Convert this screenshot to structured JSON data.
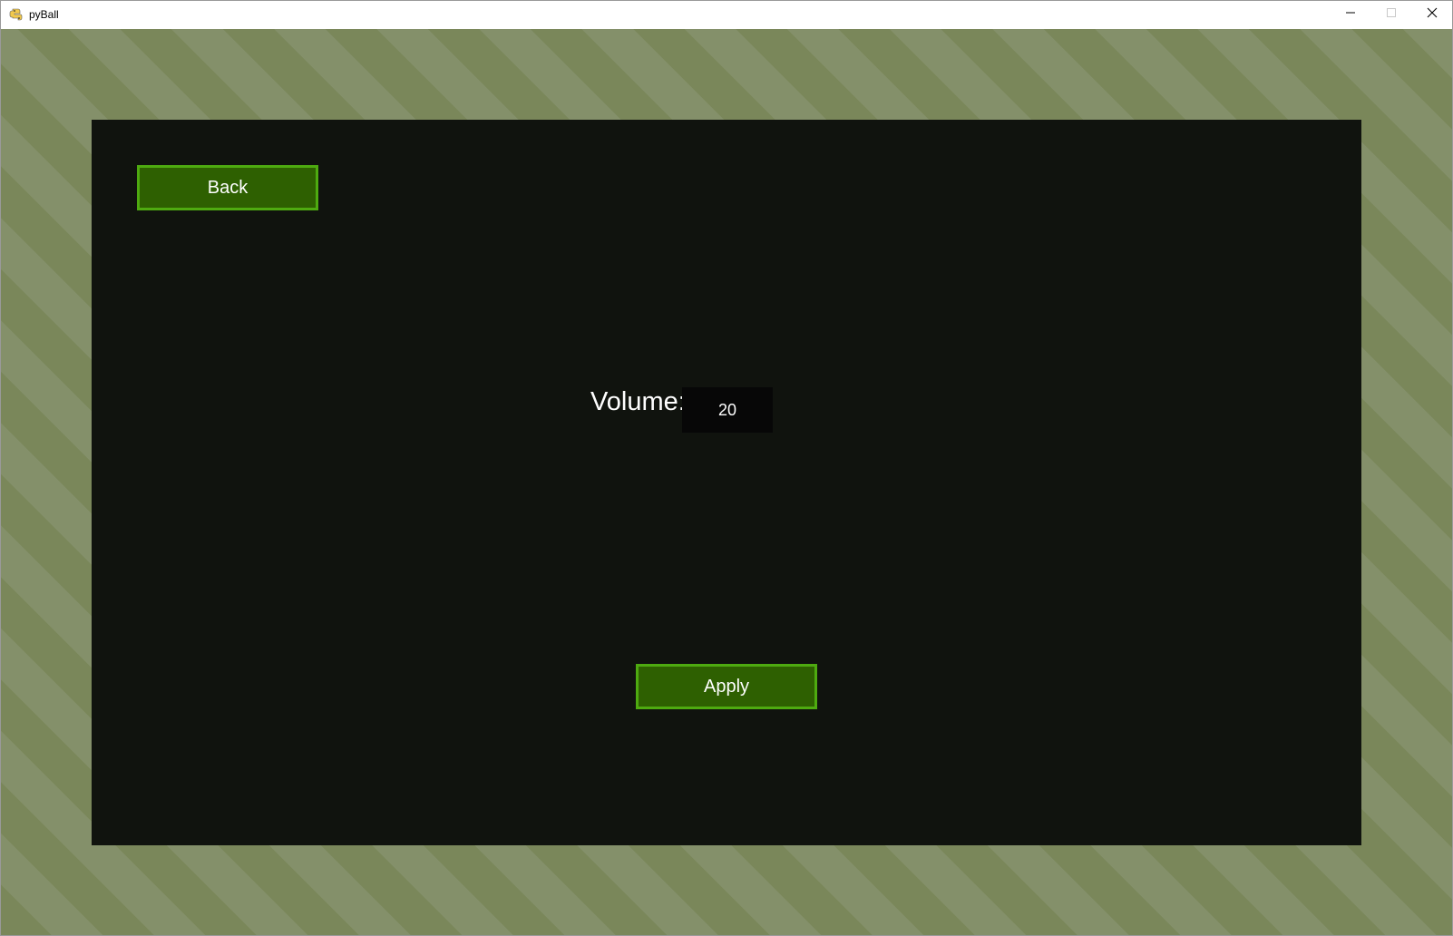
{
  "window": {
    "title": "pyBall",
    "app_icon": "python-icon",
    "controls": {
      "minimize_icon": "minimize-icon",
      "maximize_icon": "maximize-icon",
      "close_icon": "close-icon"
    }
  },
  "settings": {
    "back_label": "Back",
    "volume_label": "Volume:",
    "volume_value": "20",
    "apply_label": "Apply"
  },
  "colors": {
    "background": "#7d8a5d",
    "panel": "#10130e",
    "button_fill": "#2e6001",
    "button_border": "#4eaa10",
    "input_fill": "#070707",
    "text": "#ffffff"
  }
}
